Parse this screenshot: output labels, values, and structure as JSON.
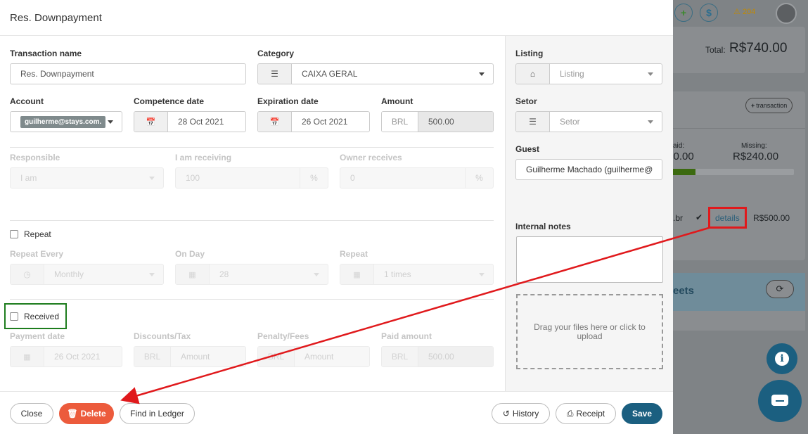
{
  "background": {
    "badge_count": "204",
    "total_label": "Total:",
    "total_value": "R$740.00",
    "transaction_btn": "transaction",
    "paid_label": "aid:",
    "paid_value": ".00.00",
    "missing_label": "Missing:",
    "missing_value": "R$240.00",
    "row_email_tail": ".br",
    "row_details": "details",
    "row_amount": "R$500.00",
    "sheets_label": "eets"
  },
  "modal": {
    "title": "Res. Downpayment",
    "transaction_name": {
      "label": "Transaction name",
      "value": "Res. Downpayment"
    },
    "category": {
      "label": "Category",
      "value": "CAIXA GERAL"
    },
    "account": {
      "label": "Account",
      "value": "guilherme@stays.com."
    },
    "competence_date": {
      "label": "Competence date",
      "value": "28 Oct 2021"
    },
    "expiration_date": {
      "label": "Expiration date",
      "value": "26 Oct 2021"
    },
    "amount": {
      "label": "Amount",
      "currency": "BRL",
      "value": "500.00"
    },
    "responsible": {
      "label": "Responsible",
      "value": "I am"
    },
    "i_am_receiving": {
      "label": "I am receiving",
      "value": "100",
      "unit": "%"
    },
    "owner_receives": {
      "label": "Owner receives",
      "value": "0",
      "unit": "%"
    },
    "repeat_checkbox": "Repeat",
    "repeat_every": {
      "label": "Repeat Every",
      "value": "Monthly"
    },
    "on_day": {
      "label": "On Day",
      "value": "28"
    },
    "repeat": {
      "label": "Repeat",
      "value": "1 times"
    },
    "received_checkbox": "Received",
    "payment_date": {
      "label": "Payment date",
      "value": "26 Oct 2021"
    },
    "discounts": {
      "label": "Discounts/Tax",
      "currency": "BRL",
      "placeholder": "Amount"
    },
    "penalty": {
      "label": "Penalty/Fees",
      "currency": "BRL",
      "placeholder": "Amount"
    },
    "paid_amount": {
      "label": "Paid amount",
      "currency": "BRL",
      "value": "500.00"
    },
    "listing": {
      "label": "Listing",
      "placeholder": "Listing"
    },
    "setor": {
      "label": "Setor",
      "placeholder": "Setor"
    },
    "guest": {
      "label": "Guest",
      "value": "Guilherme Machado (guilherme@"
    },
    "internal_notes": {
      "label": "Internal notes",
      "value": ""
    },
    "dropzone": "Drag your files here or click to upload",
    "buttons": {
      "close": "Close",
      "delete": "Delete",
      "find": "Find in Ledger",
      "history": "History",
      "receipt": "Receipt",
      "save": "Save"
    }
  },
  "colors": {
    "accent": "#1b5f80",
    "danger": "#ec5b3c",
    "annotation_red": "#e0191c",
    "annotation_green": "#1e7d1e"
  }
}
